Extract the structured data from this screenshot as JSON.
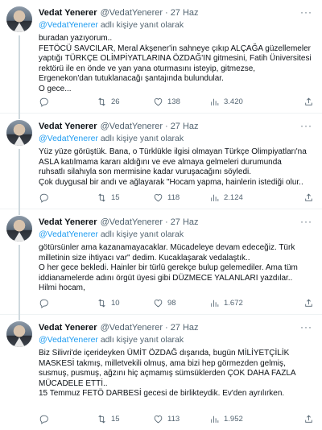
{
  "tweets": [
    {
      "name": "Vedat Yenerer",
      "handle": "@VedatYenerer",
      "date": "27 Haz",
      "reply_mention": "@VedatYenerer",
      "reply_suffix": " adlı kişiye yanıt olarak",
      "lines": [
        "buradan yazıyorum..",
        "FETÖCÜ SAVCILAR, Meral Akşener'in sahneye çıkıp ALÇAĞA güzellemeler",
        "yaptığı TÜRKÇE OLİMPİYATLARINA ÖZDAĞ'IN gitmesini, Fatih Üniversitesi",
        "rektörü ile en önde ve yan yana oturmasını isteyip, gitmezse,",
        "Ergenekon'dan tutuklanacağı şantajında bulundular.",
        "O gece..."
      ],
      "replies": "",
      "retweets": "26",
      "likes": "138",
      "views": "3.420"
    },
    {
      "name": "Vedat Yenerer",
      "handle": "@VedatYenerer",
      "date": "27 Haz",
      "reply_mention": "@VedatYenerer",
      "reply_suffix": " adlı kişiye yanıt olarak",
      "lines": [
        "Yüz yüze görüştük. Bana, o Türklükle ilgisi olmayan Türkçe Olimpiyatları'na",
        "ASLA katılmama kararı aldığını ve eve almaya gelmeleri durumunda",
        "ruhsatlı silahıyla son mermisine kadar vuruşacağını söyledi.",
        "Çok duygusal bir andı ve ağlayarak \"Hocam yapma, hainlerin istediği olur.."
      ],
      "replies": "",
      "retweets": "15",
      "likes": "118",
      "views": "2.124"
    },
    {
      "name": "Vedat Yenerer",
      "handle": "@VedatYenerer",
      "date": "27 Haz",
      "reply_mention": "@VedatYenerer",
      "reply_suffix": " adlı kişiye yanıt olarak",
      "lines": [
        "götürsünler ama kazanamayacaklar. Mücadeleye devam edeceğiz. Türk",
        "milletinin size ihtiyacı var\" dedim. Kucaklaşarak vedalaştık..",
        "O her gece bekledi. Hainler bir türlü gerekçe bulup gelemediler. Ama tüm",
        "iddianamelerde adını örgüt üyesi gibi DÜZMECE YALANLARI yazdılar..",
        "Hilmi hocam,"
      ],
      "replies": "",
      "retweets": "10",
      "likes": "98",
      "views": "1.672"
    },
    {
      "name": "Vedat Yenerer",
      "handle": "@VedatYenerer",
      "date": "27 Haz",
      "reply_mention": "@VedatYenerer",
      "reply_suffix": " adlı kişiye yanıt olarak",
      "lines": [
        "Biz Silivri'de içerideyken ÜMİT ÖZDAĞ dışarıda, bugün MİLİYETÇİLİK",
        "MASKESİ takmış, milletvekili olmuş, ama bizi  hep görmezden gelmiş,",
        "susmuş, pusmuş, ağzını hiç açmamış sümsüklerden ÇOK DAHA FAZLA",
        "MÜCADELE ETTİ..",
        "15 Temmuz FETÖ DARBESİ gecesi de birlikteydik. Ev'den ayrılırken."
      ],
      "replies": "",
      "retweets": "15",
      "likes": "113",
      "views": "1.952"
    }
  ],
  "more_label": "···"
}
